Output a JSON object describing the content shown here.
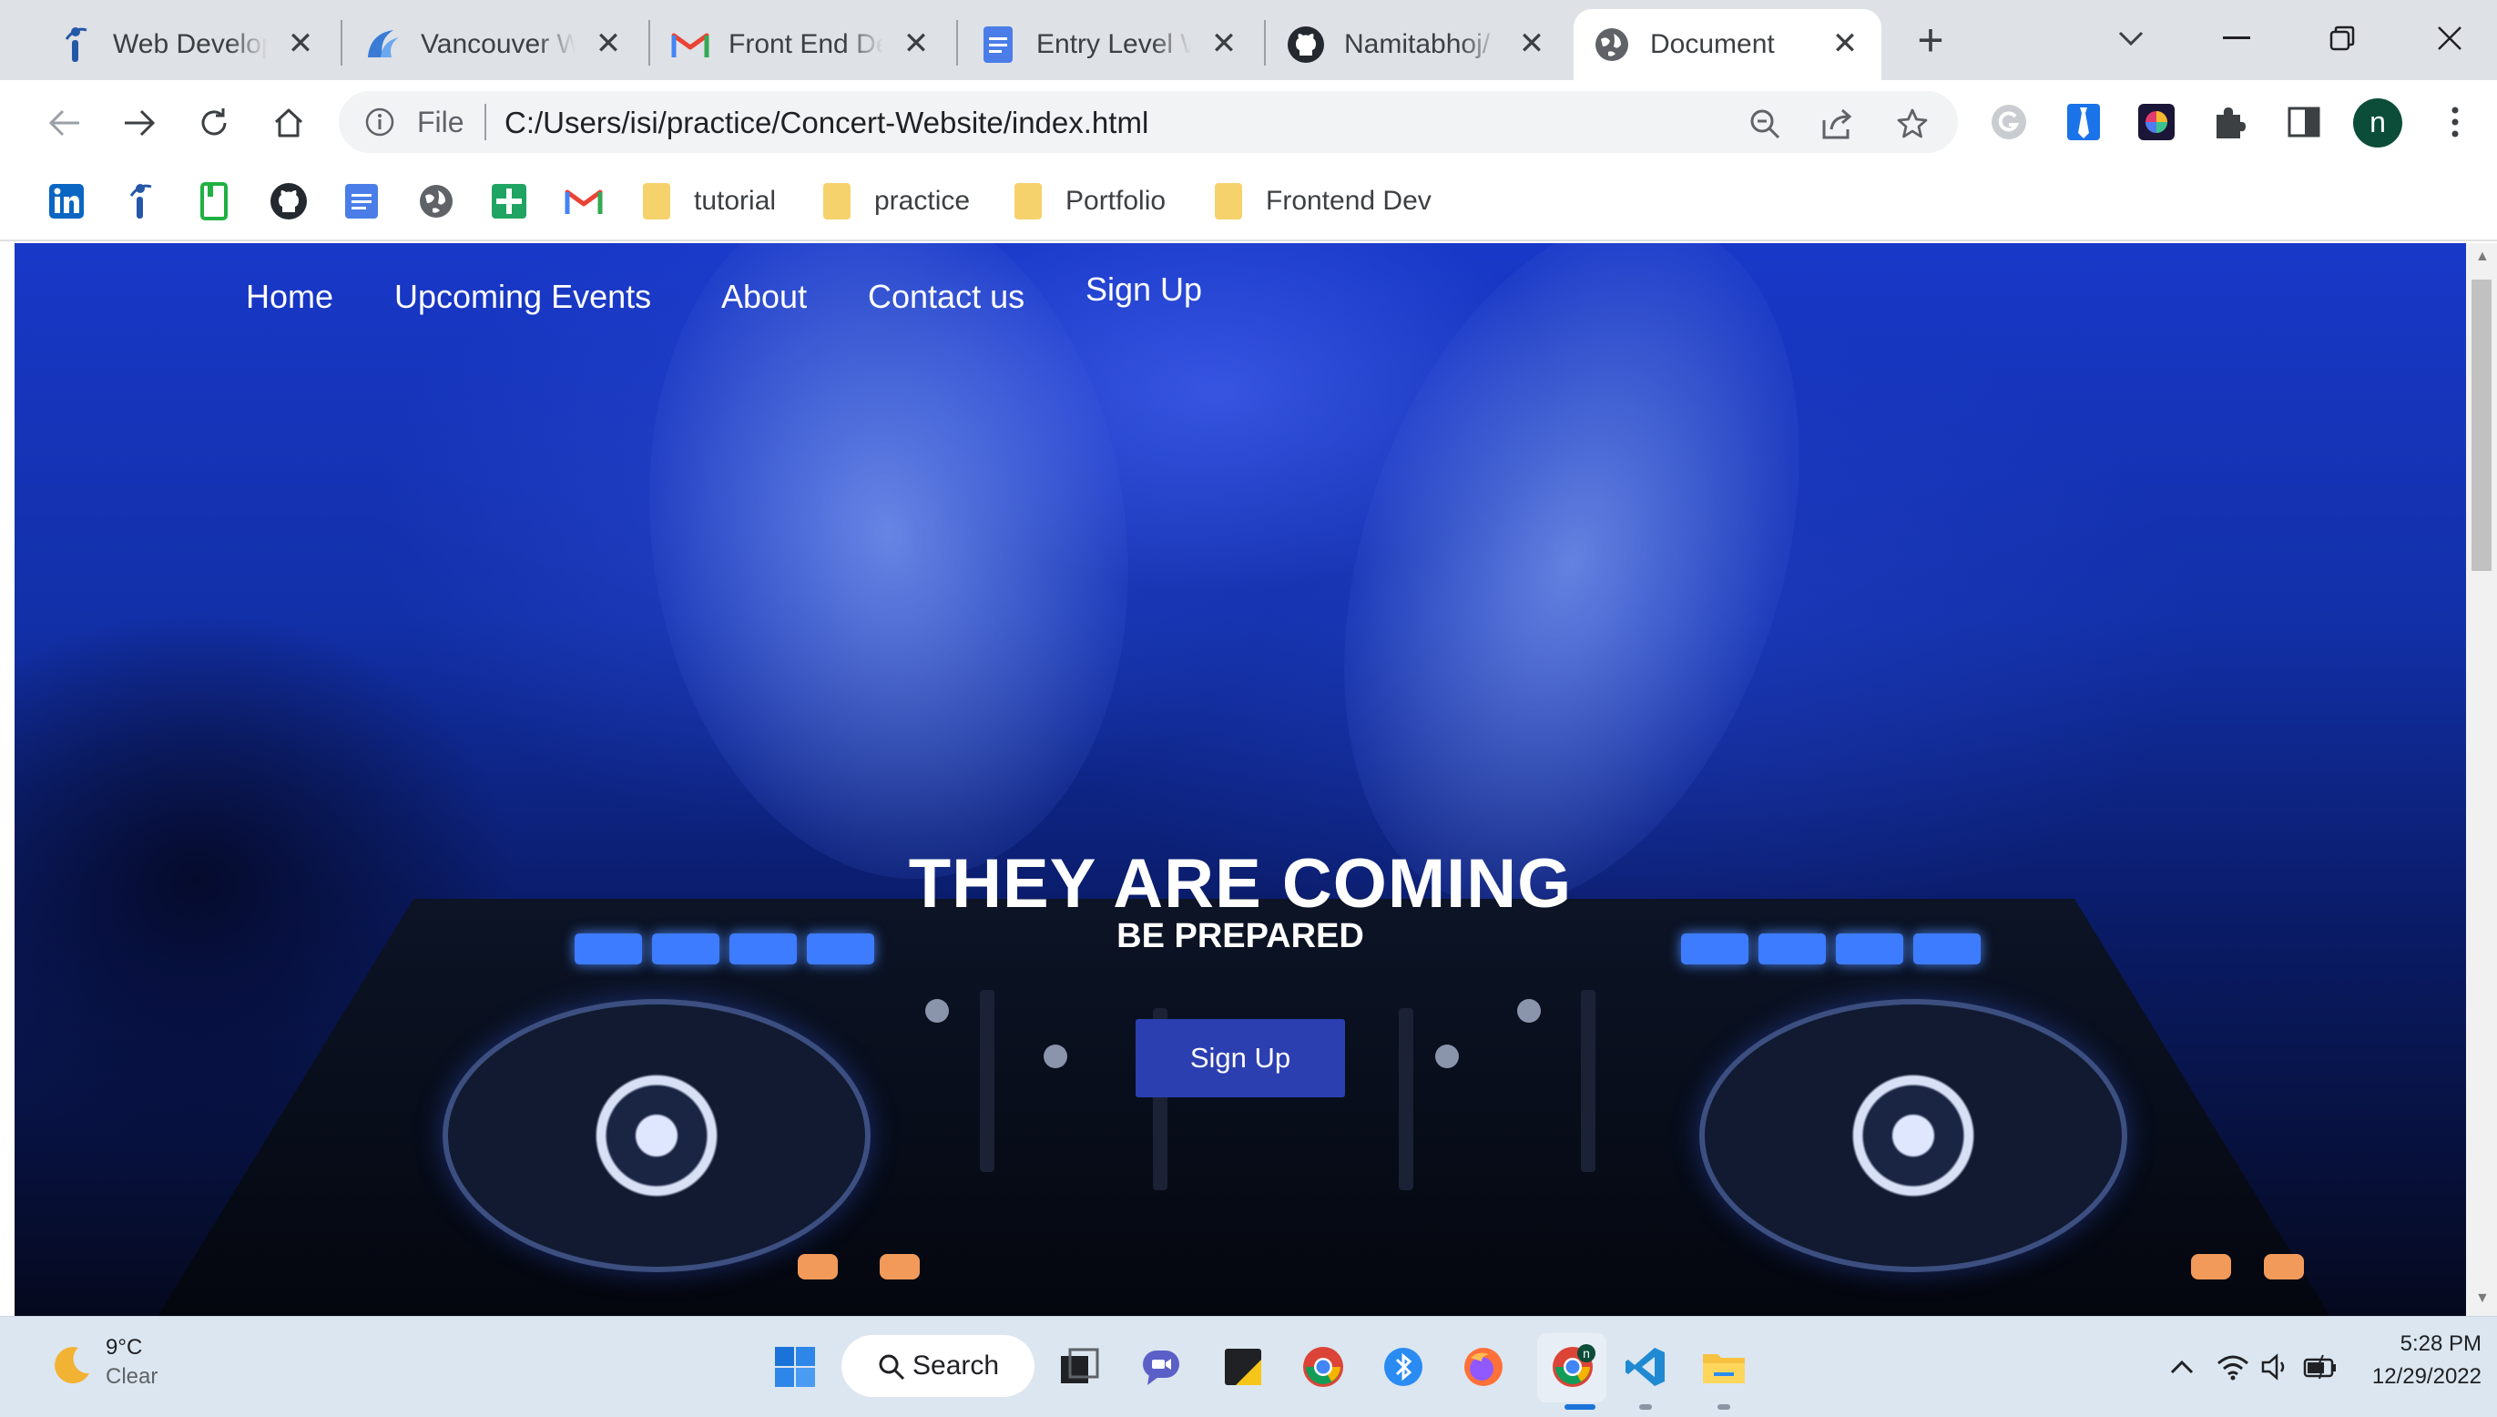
{
  "browser": {
    "tabs": [
      {
        "title": "Web Develop",
        "icon": "indeed-icon",
        "active": false
      },
      {
        "title": "Vancouver W",
        "icon": "vancouver-logo-icon",
        "active": false
      },
      {
        "title": "Front End De",
        "icon": "gmail-icon",
        "active": false
      },
      {
        "title": "Entry Level W",
        "icon": "google-docs-icon",
        "active": false
      },
      {
        "title": "Namitabhoj/",
        "icon": "github-icon",
        "active": false
      },
      {
        "title": "Document",
        "icon": "globe-icon",
        "active": true
      }
    ],
    "address": {
      "scheme_label": "File",
      "url": "C:/Users/isi/practice/Concert-Website/index.html"
    },
    "profile_initial": "n",
    "bookmarks": {
      "icons": [
        "linkedin-icon",
        "indeed-icon",
        "evernote-icon",
        "github-icon",
        "google-docs-icon",
        "globe-icon",
        "google-sheets-icon",
        "gmail-icon"
      ],
      "folders": [
        "tutorial",
        "practice",
        "Portfolio",
        "Frontend Dev"
      ]
    }
  },
  "site": {
    "nav": [
      "Home",
      "Upcoming Events",
      "About",
      "Contact us",
      "Sign Up"
    ],
    "hero": {
      "title": "THEY ARE COMING",
      "subtitle": "BE PREPARED",
      "button": "Sign Up"
    }
  },
  "taskbar": {
    "weather": {
      "temp": "9°C",
      "condition": "Clear"
    },
    "search_label": "Search",
    "chrome_badge": "n",
    "clock": {
      "time": "5:28 PM",
      "date": "12/29/2022"
    }
  },
  "colors": {
    "hero_button": "#2c3fb1",
    "tab_strip": "#dee1e6",
    "taskbar": "#dbe6f0"
  }
}
